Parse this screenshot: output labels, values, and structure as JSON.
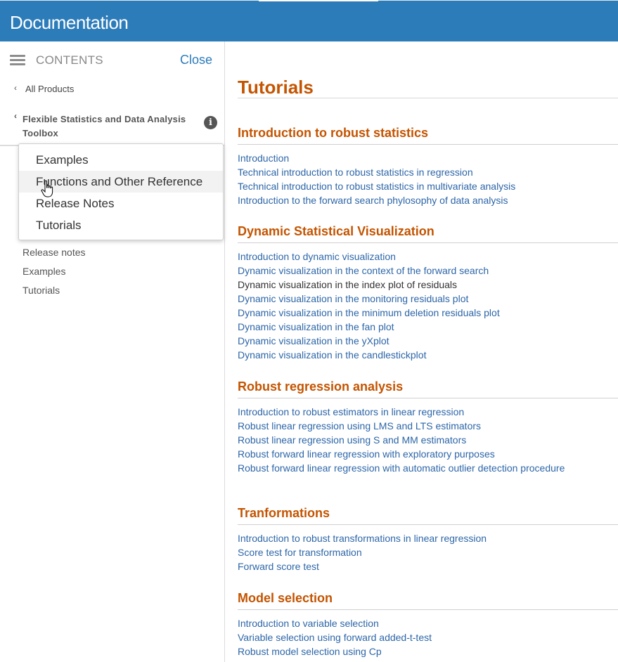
{
  "header": {
    "title": "Documentation"
  },
  "sidebar": {
    "contents_label": "CONTENTS",
    "close_label": "Close",
    "all_products_label": "All Products",
    "product_title": "Flexible Statistics and Data Analysis Toolbox",
    "links": [
      "Release notes",
      "Examples",
      "Tutorials"
    ]
  },
  "dropdown": {
    "options": [
      "Examples",
      "Functions and Other Reference",
      "Release Notes",
      "Tutorials"
    ],
    "hovered": "Functions and Other Reference"
  },
  "main": {
    "title": "Tutorials",
    "sections": [
      {
        "heading": "Introduction to robust statistics",
        "links": [
          "Introduction",
          "Technical introduction to robust statistics in regression",
          "Technical introduction to robust statistics in multivariate analysis",
          "Introduction to the forward search phylosophy of data analysis"
        ]
      },
      {
        "heading": "Dynamic Statistical Visualization",
        "links": [
          "Introduction to dynamic visualization",
          "Dynamic visualization in the context of the forward search",
          "Dynamic visualization in the index plot of residuals",
          "Dynamic visualization in the monitoring residuals plot",
          "Dynamic visualization in the minimum deletion residuals plot",
          "Dynamic visualization in the fan plot",
          "Dynamic visualization in the yXplot",
          "Dynamic visualization in the candlestickplot"
        ]
      },
      {
        "heading": "Robust regression analysis",
        "links": [
          "Introduction to robust estimators in linear regression",
          "Robust linear regression using LMS and LTS estimators",
          "Robust linear regression using S and MM estimators",
          "Robust forward linear regression with exploratory purposes",
          "Robust forward linear regression with automatic outlier detection procedure"
        ]
      },
      {
        "heading": "Tranformations",
        "links": [
          "Introduction to robust transformations in linear regression",
          "Score test for transformation",
          "Forward score test"
        ]
      },
      {
        "heading": "Model selection",
        "links": [
          "Introduction to variable selection",
          "Variable selection using forward added-t-test",
          "Robust model selection using Cp"
        ]
      }
    ]
  },
  "colors": {
    "brand_blue": "#2d7cba",
    "heading_orange": "#c45400",
    "link_blue": "#2d66a8"
  }
}
